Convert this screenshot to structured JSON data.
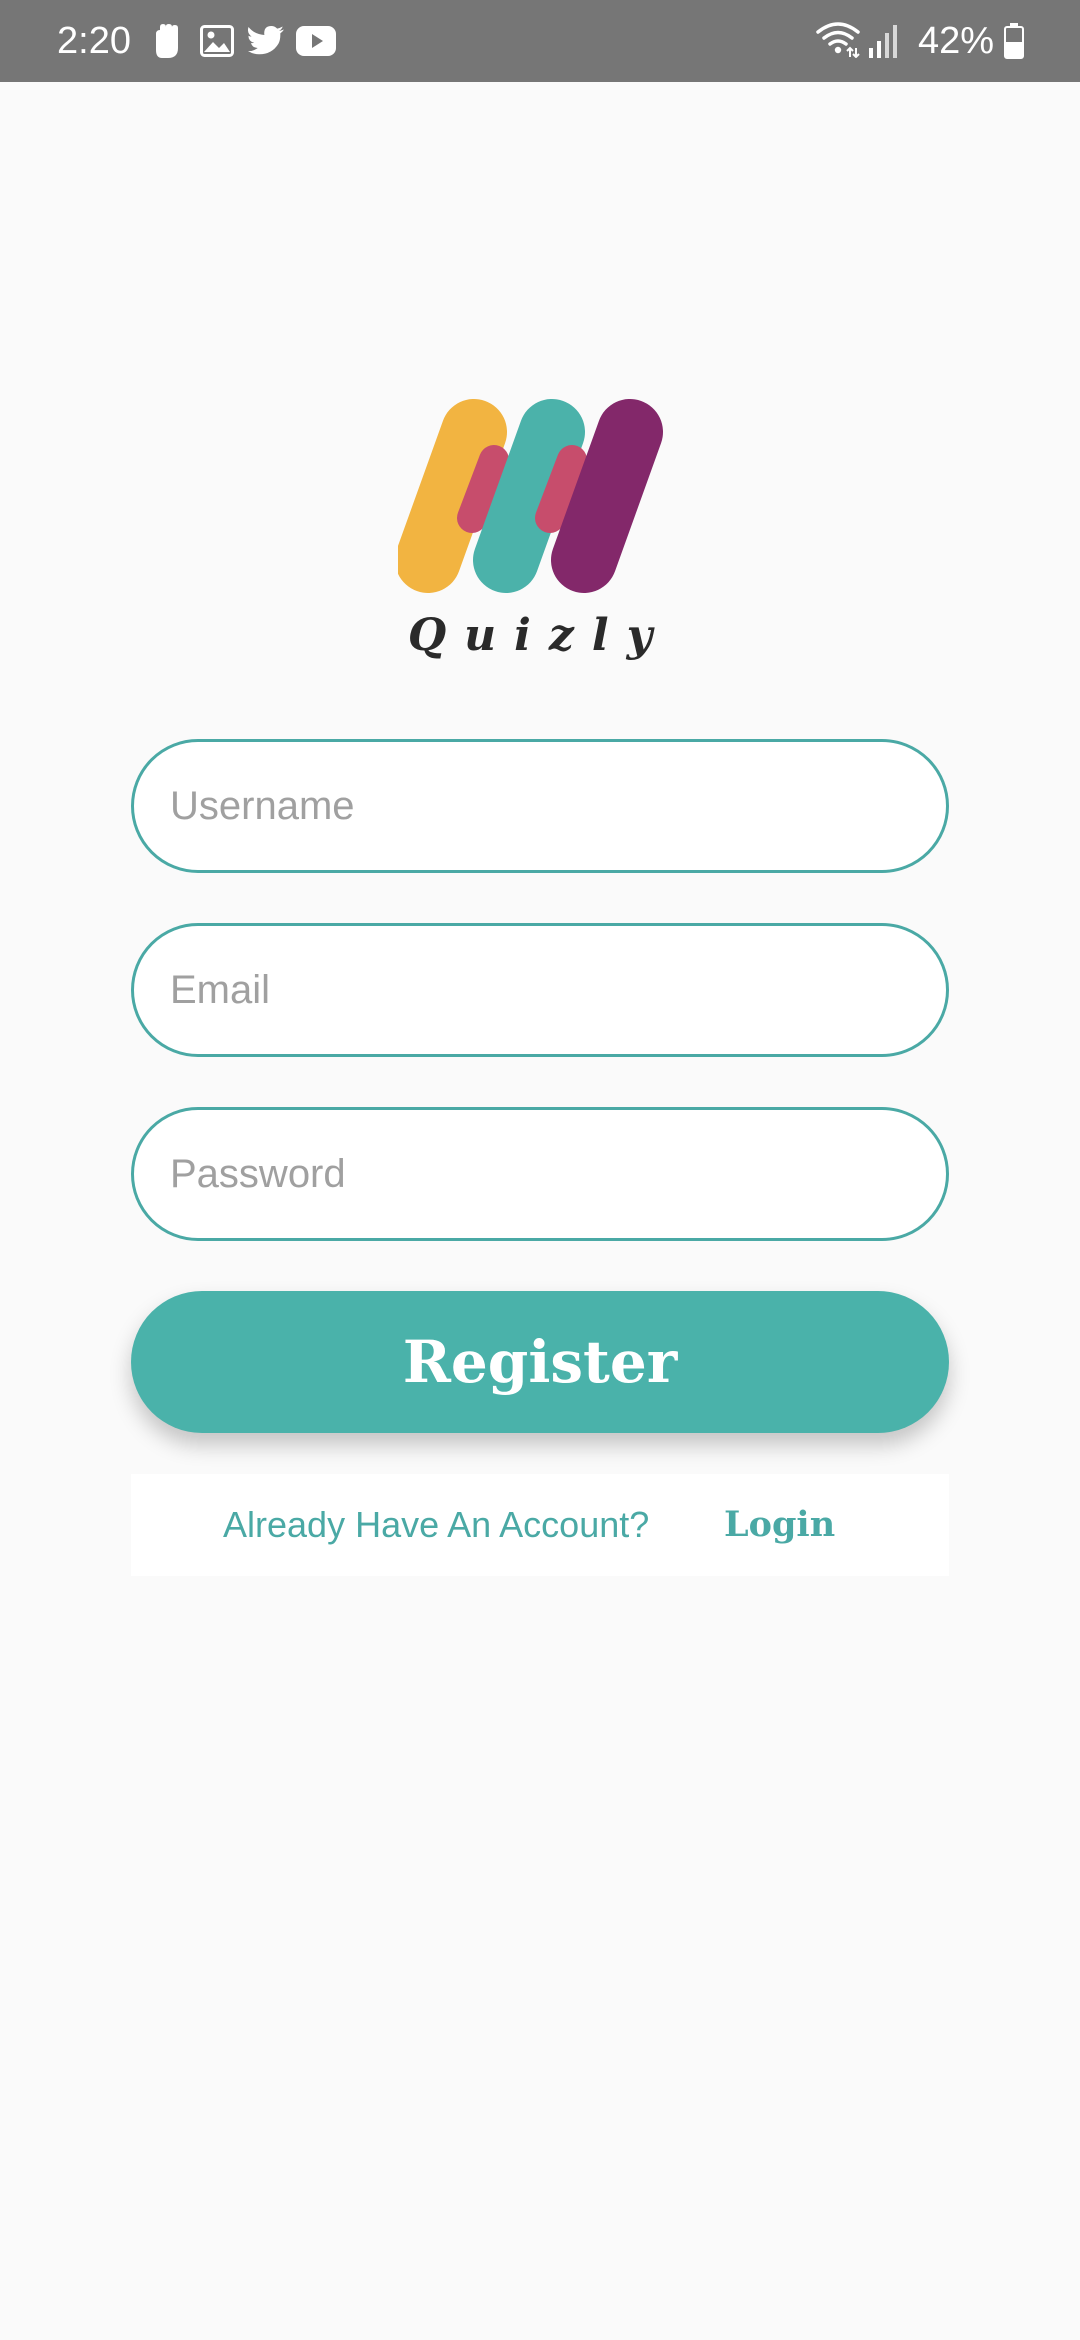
{
  "status_bar": {
    "time": "2:20",
    "battery_percent": "42%",
    "left_icons": [
      "notification-hand-icon",
      "gallery-icon",
      "twitter-icon",
      "youtube-icon"
    ],
    "right_icons": [
      "wifi-icon",
      "signal-icon",
      "battery-icon"
    ]
  },
  "logo": {
    "text": "Quizly",
    "colors": {
      "stroke_1": "#f2b441",
      "stroke_2": "#4bb2aa",
      "stroke_3": "#83286a",
      "overlap": "#c74d6c"
    }
  },
  "form": {
    "username_placeholder": "Username",
    "email_placeholder": "Email",
    "password_placeholder": "Password",
    "register_label": "Register"
  },
  "login_row": {
    "prompt": "Already Have An Account?",
    "login_label": "Login"
  },
  "theme": {
    "accent": "#4aa9a5",
    "button": "#4ab2aa",
    "status_bar": "#767676",
    "background": "#fafafa"
  }
}
